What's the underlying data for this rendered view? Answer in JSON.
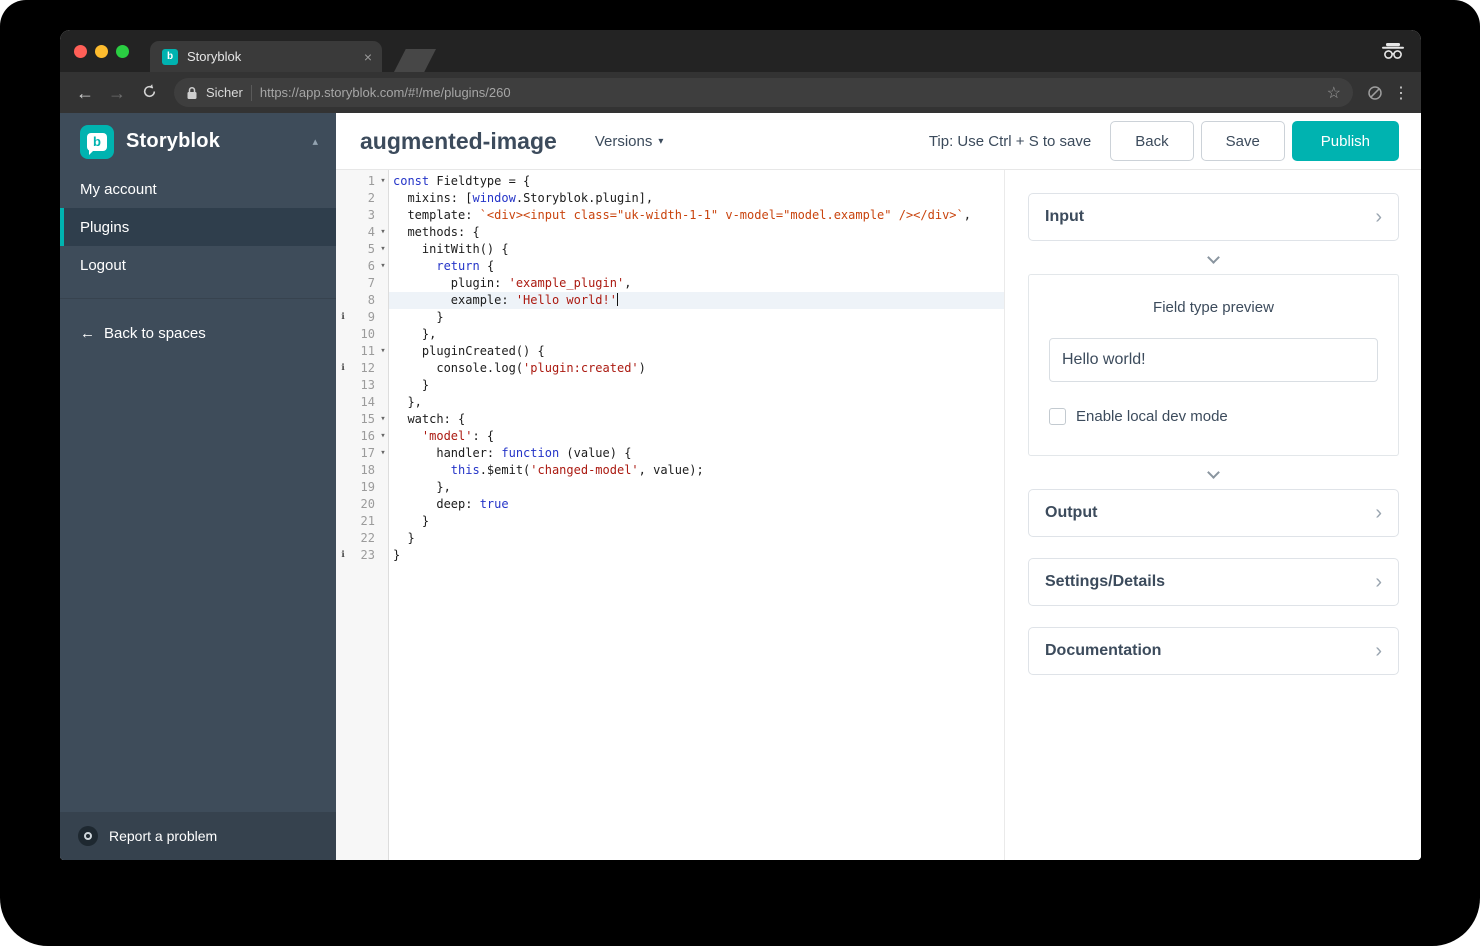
{
  "browser": {
    "tab_title": "Storyblok",
    "security_label": "Sicher",
    "url": "https://app.storyblok.com/#!/me/plugins/260"
  },
  "sidebar": {
    "brand": "Storyblok",
    "items": [
      {
        "label": "My account",
        "active": false
      },
      {
        "label": "Plugins",
        "active": true
      },
      {
        "label": "Logout",
        "active": false
      }
    ],
    "back_link": "Back to spaces",
    "report_problem": "Report a problem"
  },
  "header": {
    "title": "augmented-image",
    "versions": "Versions",
    "tip": "Tip: Use Ctrl + S to save",
    "buttons": {
      "back": "Back",
      "save": "Save",
      "publish": "Publish"
    }
  },
  "editor": {
    "lines": [
      {
        "n": 1,
        "fold": true,
        "tokens": [
          [
            "k",
            "const"
          ],
          [
            "p",
            " Fieldtype = {"
          ]
        ]
      },
      {
        "n": 2,
        "tokens": [
          [
            "p",
            "  mixins: ["
          ],
          [
            "k",
            "window"
          ],
          [
            "p",
            ".Storyblok.plugin],"
          ]
        ]
      },
      {
        "n": 3,
        "tokens": [
          [
            "p",
            "  template: "
          ],
          [
            "t",
            "`<div><input class=\"uk-width-1-1\" v-model=\"model.example\" /></div>`"
          ],
          [
            "p",
            ","
          ]
        ]
      },
      {
        "n": 4,
        "fold": true,
        "tokens": [
          [
            "p",
            "  methods: {"
          ]
        ]
      },
      {
        "n": 5,
        "fold": true,
        "tokens": [
          [
            "p",
            "    initWith() {"
          ]
        ]
      },
      {
        "n": 6,
        "fold": true,
        "tokens": [
          [
            "p",
            "      "
          ],
          [
            "k",
            "return"
          ],
          [
            "p",
            " {"
          ]
        ]
      },
      {
        "n": 7,
        "tokens": [
          [
            "p",
            "        plugin: "
          ],
          [
            "s",
            "'example_plugin'"
          ],
          [
            "p",
            ","
          ]
        ]
      },
      {
        "n": 8,
        "active": true,
        "cursor": true,
        "tokens": [
          [
            "p",
            "        example: "
          ],
          [
            "s",
            "'Hello world!'"
          ]
        ]
      },
      {
        "n": 9,
        "marker": true,
        "tokens": [
          [
            "p",
            "      }"
          ]
        ]
      },
      {
        "n": 10,
        "tokens": [
          [
            "p",
            "    },"
          ]
        ]
      },
      {
        "n": 11,
        "fold": true,
        "tokens": [
          [
            "p",
            "    pluginCreated() {"
          ]
        ]
      },
      {
        "n": 12,
        "marker": true,
        "tokens": [
          [
            "p",
            "      console.log("
          ],
          [
            "s",
            "'plugin:created'"
          ],
          [
            "p",
            ")"
          ]
        ]
      },
      {
        "n": 13,
        "tokens": [
          [
            "p",
            "    }"
          ]
        ]
      },
      {
        "n": 14,
        "tokens": [
          [
            "p",
            "  },"
          ]
        ]
      },
      {
        "n": 15,
        "fold": true,
        "tokens": [
          [
            "p",
            "  watch: {"
          ]
        ]
      },
      {
        "n": 16,
        "fold": true,
        "tokens": [
          [
            "p",
            "    "
          ],
          [
            "s",
            "'model'"
          ],
          [
            "p",
            ": {"
          ]
        ]
      },
      {
        "n": 17,
        "fold": true,
        "tokens": [
          [
            "p",
            "      handler: "
          ],
          [
            "k",
            "function"
          ],
          [
            "p",
            " (value) {"
          ]
        ]
      },
      {
        "n": 18,
        "tokens": [
          [
            "p",
            "        "
          ],
          [
            "k",
            "this"
          ],
          [
            "p",
            ".$emit("
          ],
          [
            "s",
            "'changed-model'"
          ],
          [
            "p",
            ", value);"
          ]
        ]
      },
      {
        "n": 19,
        "tokens": [
          [
            "p",
            "      },"
          ]
        ]
      },
      {
        "n": 20,
        "tokens": [
          [
            "p",
            "      deep: "
          ],
          [
            "k",
            "true"
          ]
        ]
      },
      {
        "n": 21,
        "tokens": [
          [
            "p",
            "    }"
          ]
        ]
      },
      {
        "n": 22,
        "tokens": [
          [
            "p",
            "  }"
          ]
        ]
      },
      {
        "n": 23,
        "marker": true,
        "tokens": [
          [
            "p",
            "}"
          ]
        ]
      }
    ]
  },
  "panel": {
    "sections": {
      "input": "Input",
      "output": "Output",
      "settings": "Settings/Details",
      "documentation": "Documentation"
    },
    "preview": {
      "title": "Field type preview",
      "input_value": "Hello world!",
      "dev_mode_label": "Enable local dev mode",
      "dev_mode_checked": false
    }
  },
  "icons": {
    "tab_close": "×",
    "back_arrow": "←",
    "forward_arrow": "→",
    "star": "☆",
    "menu_dots": "⋮",
    "brand_caret": "▴",
    "versions_caret": "▾",
    "fold_arrow": "▾",
    "lint_marker": "ℹ",
    "chevron_right": "›",
    "back_to_spaces_arrow": "←",
    "favicon_letter": "b",
    "logo_letter": "b"
  },
  "colors": {
    "accent_teal": "#00b3b0",
    "sidebar_bg": "#3e4c5a",
    "keyword": "#2434c8",
    "string": "#ab1a11",
    "template_string": "#c9440e",
    "active_line": "#eef3f8"
  }
}
